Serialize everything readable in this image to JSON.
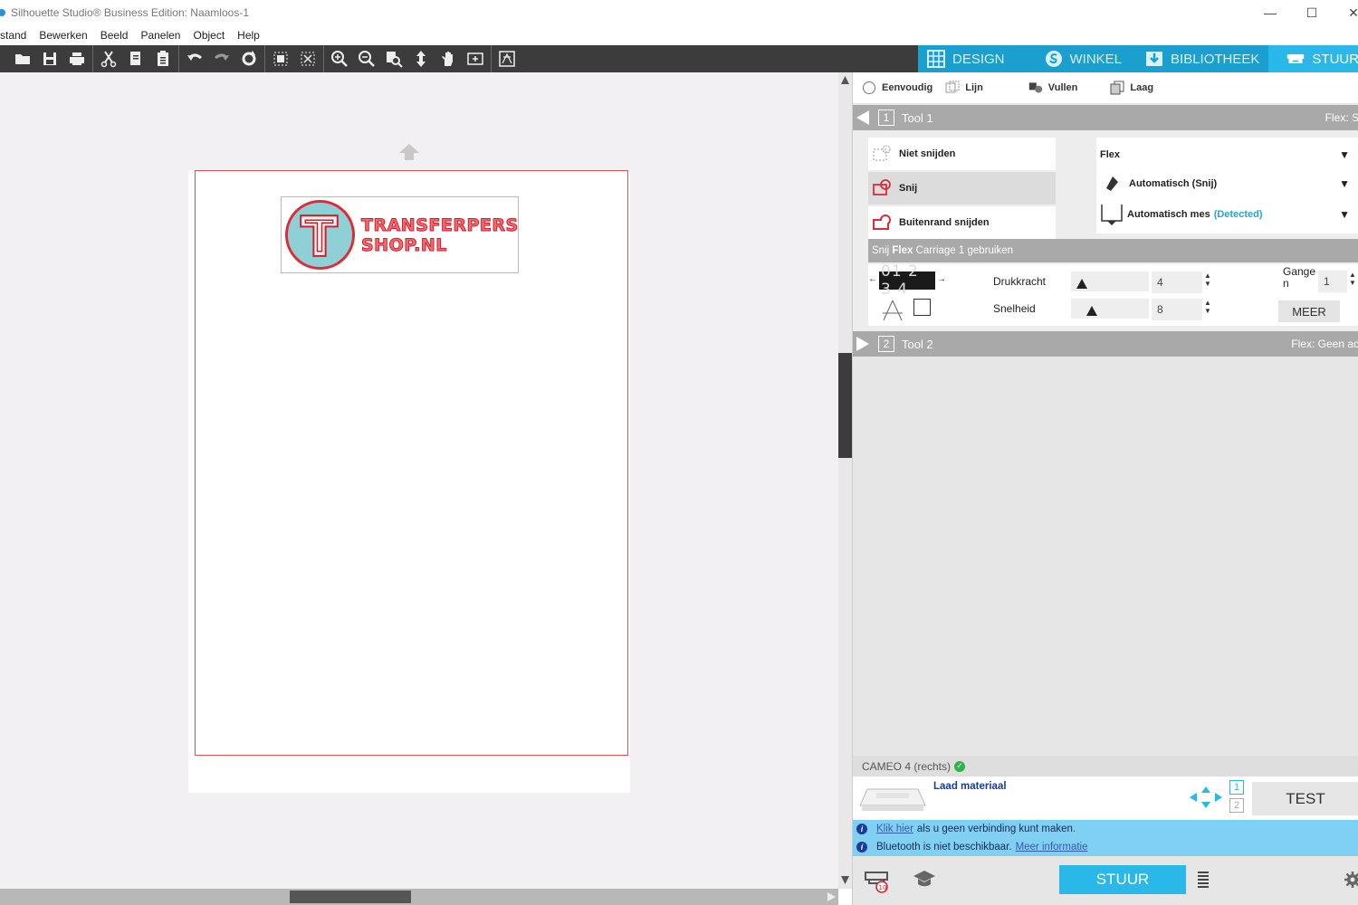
{
  "window": {
    "title": "Silhouette Studio® Business Edition: Naamloos-1"
  },
  "menu": [
    "stand",
    "Bewerken",
    "Beeld",
    "Panelen",
    "Object",
    "Help"
  ],
  "tabs": [
    {
      "label": "DESIGN",
      "icon": "grid-icon"
    },
    {
      "label": "WINKEL",
      "icon": "store-icon"
    },
    {
      "label": "BIBLIOTHEEK",
      "icon": "library-icon"
    },
    {
      "label": "STUUR",
      "icon": "cutter-icon"
    }
  ],
  "canvas": {
    "logo_line1": "TRANSFERPERS",
    "logo_line2": "SHOP.NL"
  },
  "panel": {
    "mode_tabs": [
      "Eenvoudig",
      "Lijn",
      "Vullen",
      "Laag"
    ],
    "tool1": {
      "number": "1",
      "label": "Tool 1",
      "right": "Flex: S",
      "cut_options": [
        "Niet snijden",
        "Snij",
        "Buitenrand snijden"
      ],
      "material": "Flex",
      "action": "Automatisch (Snij)",
      "tool_name": "Automatisch mes",
      "tool_status": "(Detected)",
      "info_prefix": "Snij ",
      "info_bold": "Flex",
      "info_suffix": " Carriage 1 gebruiken",
      "blade_numbers": "01 2 3 4",
      "pressure_label": "Drukkracht",
      "pressure_value": "4",
      "speed_label": "Snelheid",
      "speed_value": "8",
      "passes_label_a": "Gange",
      "passes_label_b": "n",
      "passes_value": "1",
      "more_button": "MEER"
    },
    "tool2": {
      "number": "2",
      "label": "Tool 2",
      "right": "Flex: Geen ac"
    },
    "device": "CAMEO 4 (rechts)",
    "load_material": "Laad materiaal",
    "carriage_1": "1",
    "carriage_2": "2",
    "test_button": "TEST",
    "notice1_link": "Klik hier",
    "notice1_text": "als u geen verbinding kunt maken.",
    "notice2_text": "Bluetooth is niet beschikbaar.",
    "notice2_link": "Meer informatie",
    "send_button": "STUUR"
  },
  "colors": {
    "tab_bar": "#1a9fce",
    "tab_active": "#29b8e8",
    "cut_line": "#e0525a",
    "notice_bg": "#7fd0f2",
    "ok_green": "#2db34a"
  }
}
